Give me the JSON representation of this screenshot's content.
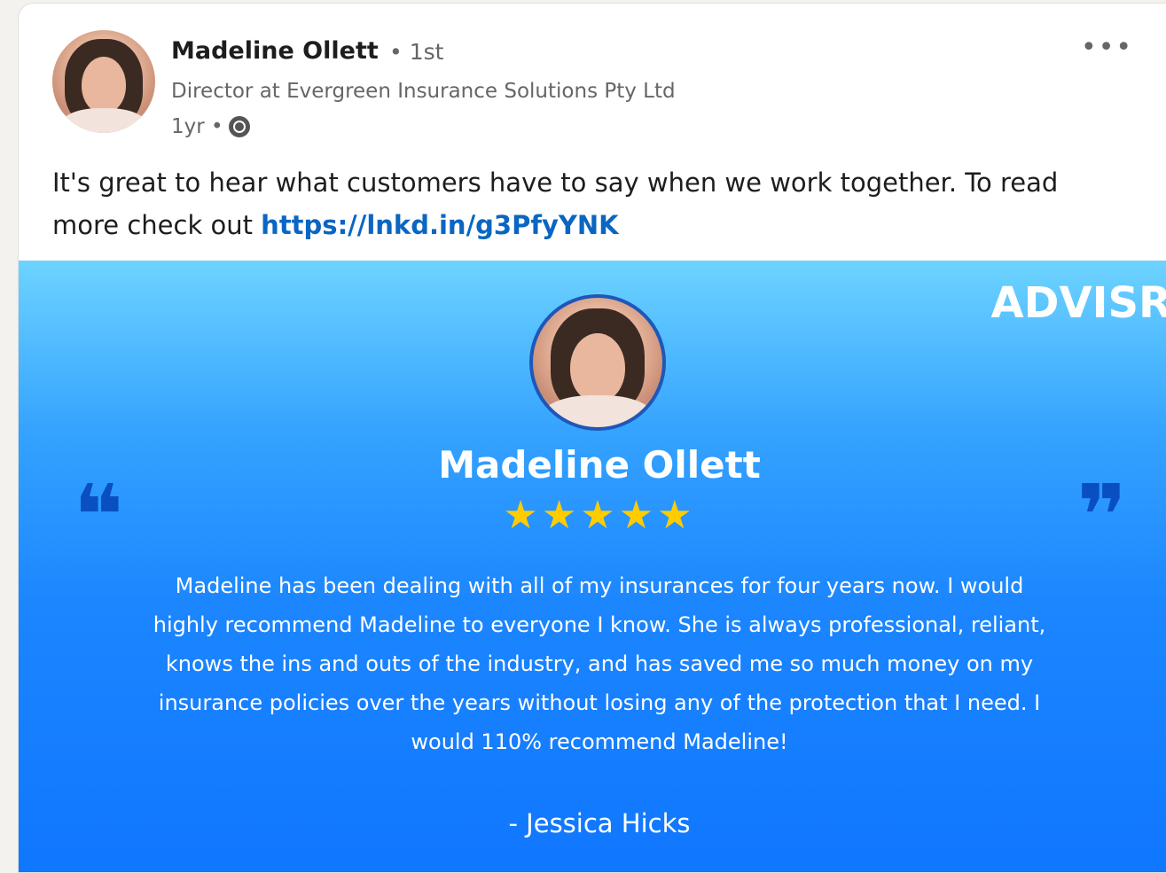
{
  "post": {
    "author_name": "Madeline Ollett",
    "degree": "• 1st",
    "headline": "Director at Evergreen Insurance Solutions Pty Ltd",
    "time": "1yr •",
    "more_label": "•••",
    "text_prefix": "It's great to hear what customers have to say when we work together. To read more check out ",
    "link": "https://lnkd.in/g3PfyYNK"
  },
  "testimonial": {
    "brand": "ADVISR",
    "name": "Madeline Ollett",
    "stars": "★★★★★",
    "rating": 5,
    "quote_open": "❝",
    "quote_close": "❞",
    "text": "Madeline has been dealing with all of my insurances for four years now. I would highly recommend Madeline to everyone I know. She is always professional, reliant,  knows the ins and outs of the industry, and has saved me so much money on my insurance policies over the years without losing any of the protection that I need. I would 110% recommend Madeline!",
    "author": "- Jessica Hicks"
  },
  "icons": {
    "visibility": "globe-icon",
    "menu": "more-options-icon"
  }
}
